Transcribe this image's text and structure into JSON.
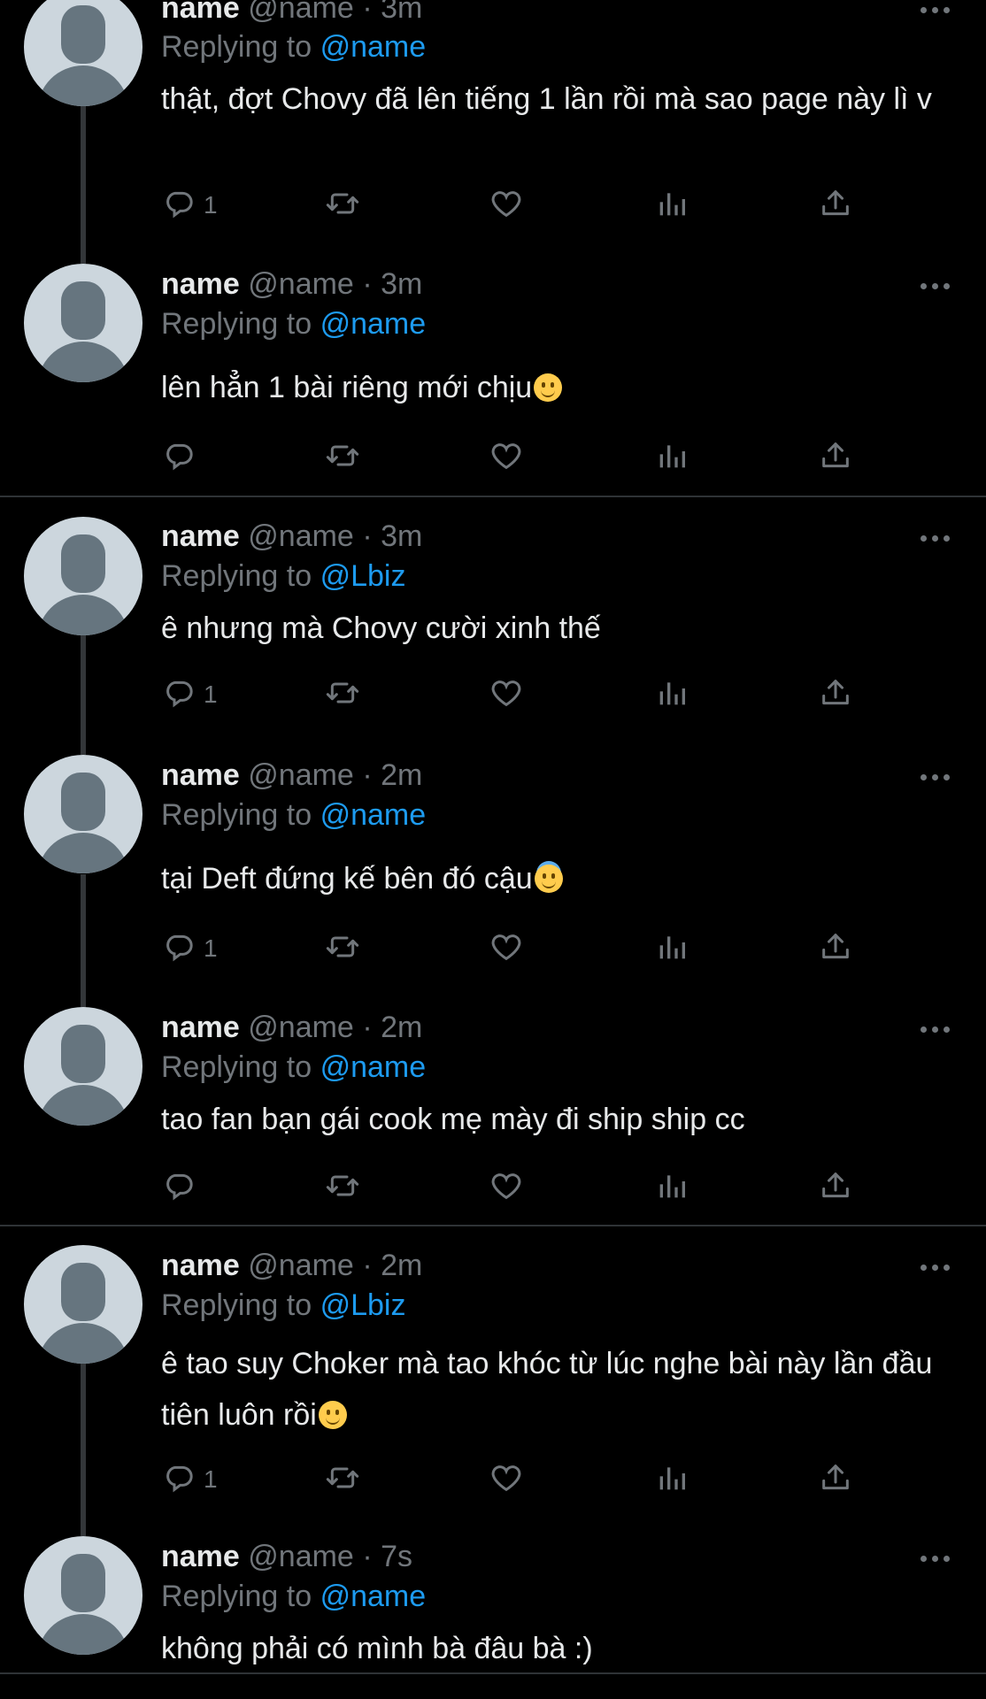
{
  "tweets": [
    {
      "name": "name",
      "handle": "@name",
      "time": "3m",
      "replying_prefix": "Replying to",
      "replying_to": "@name",
      "text": "thật, đợt Chovy đã lên tiếng 1 lần rồi mà sao page này lì v",
      "emoji": "",
      "reply_count": "1"
    },
    {
      "name": "name",
      "handle": "@name",
      "time": "3m",
      "replying_prefix": "Replying to",
      "replying_to": "@name",
      "text": "lên hẳn 1 bài riêng mới chịu",
      "emoji": "slightly-smiling-face",
      "reply_count": ""
    },
    {
      "name": "name",
      "handle": "@name",
      "time": "3m",
      "replying_prefix": "Replying to",
      "replying_to": "@Lbiz",
      "text": "ê nhưng mà Chovy cười xinh thế",
      "emoji": "",
      "reply_count": "1"
    },
    {
      "name": "name",
      "handle": "@name",
      "time": "2m",
      "replying_prefix": "Replying to",
      "replying_to": "@name",
      "text": "tại Deft đứng kế bên đó cậu",
      "emoji": "smiling-face-with-halo",
      "reply_count": "1"
    },
    {
      "name": "name",
      "handle": "@name",
      "time": "2m",
      "replying_prefix": "Replying to",
      "replying_to": "@name",
      "text": "tao fan bạn gái cook mẹ mày đi ship ship cc",
      "emoji": "",
      "reply_count": ""
    },
    {
      "name": "name",
      "handle": "@name",
      "time": "2m",
      "replying_prefix": "Replying to",
      "replying_to": "@Lbiz",
      "text": "ê tao suy Choker mà tao khóc từ lúc nghe bài này lần đầu tiên luôn rồi",
      "emoji": "slightly-smiling-face",
      "reply_count": "1"
    },
    {
      "name": "name",
      "handle": "@name",
      "time": "7s",
      "replying_prefix": "Replying to",
      "replying_to": "@name",
      "text": "không phải có mình bà đâu bà :)",
      "emoji": "",
      "reply_count": ""
    }
  ],
  "separator": "·",
  "icons": {
    "reply": "reply-icon",
    "retweet": "retweet-icon",
    "like": "like-icon",
    "views": "views-icon",
    "share": "share-icon",
    "more": "more-icon"
  },
  "colors": {
    "background": "#000000",
    "text": "#e7e9ea",
    "secondary": "#71767b",
    "accent": "#1d9bf0",
    "divider": "#2f3336"
  }
}
